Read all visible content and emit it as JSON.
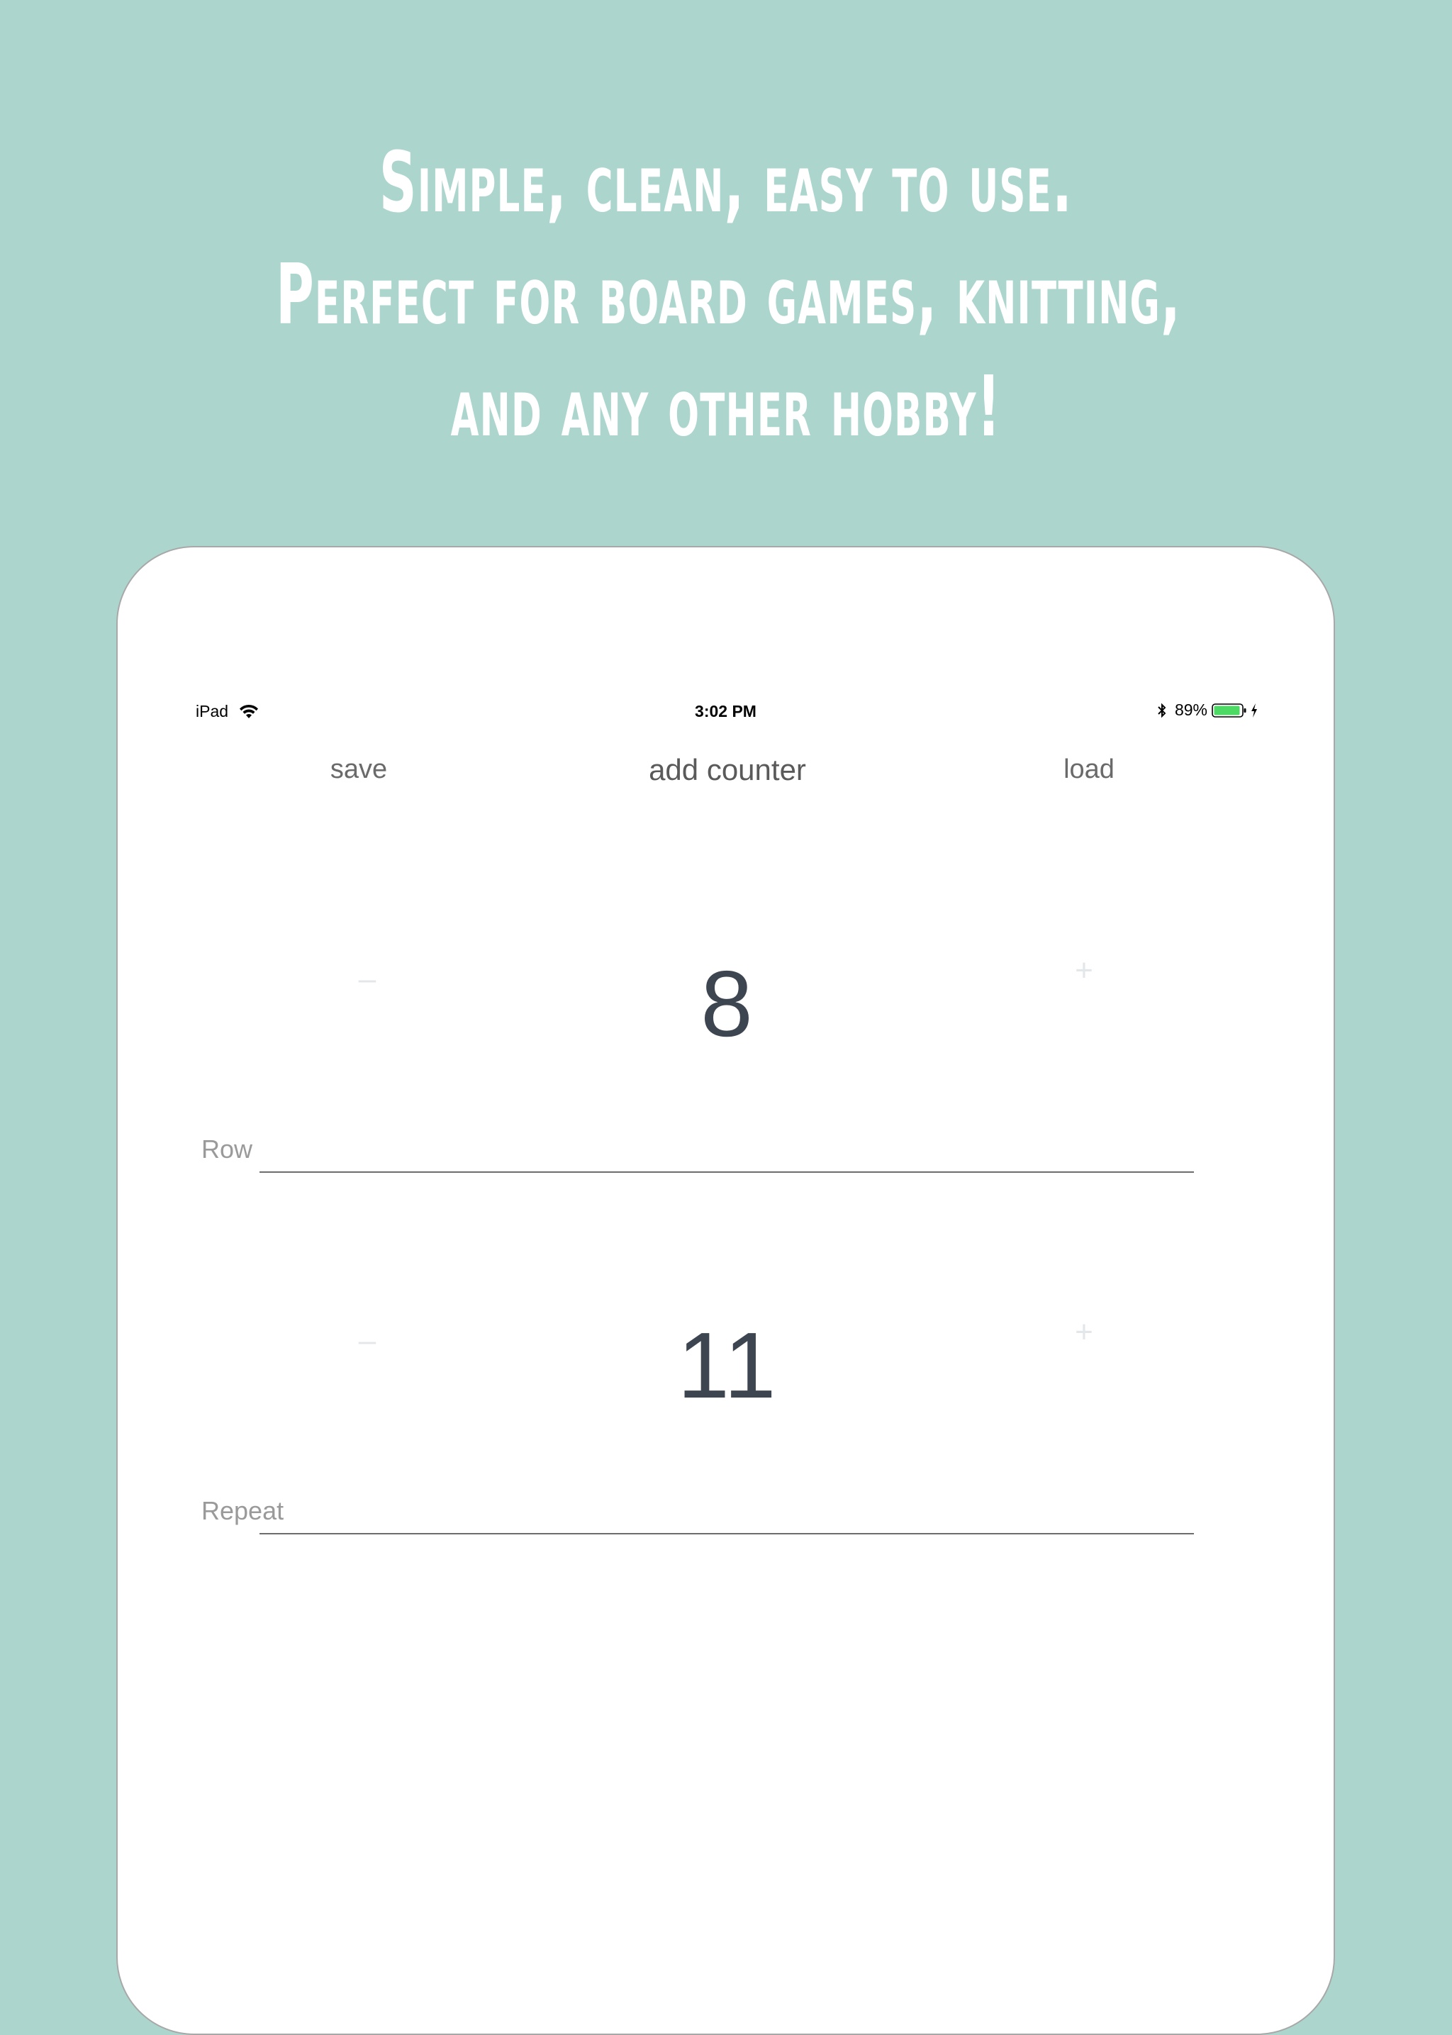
{
  "headline": {
    "line1": "Simple, clean, easy to use.",
    "line2": "Perfect for board games, knitting,",
    "line3": "and any other hobby!"
  },
  "status_bar": {
    "device": "iPad",
    "time": "3:02 PM",
    "battery": "89%",
    "battery_color": "#4cd964",
    "icons": [
      "wifi-icon",
      "bluetooth-icon",
      "battery-icon",
      "charging-icon"
    ]
  },
  "toolbar": {
    "save_label": "save",
    "add_label": "add counter",
    "load_label": "load"
  },
  "counters": [
    {
      "minus": "–",
      "value": "8",
      "plus": "+",
      "label": "Row"
    },
    {
      "minus": "–",
      "value": "11",
      "plus": "+",
      "label": "Repeat"
    }
  ],
  "colors": {
    "background": "#acd6cd",
    "card": "#ffffff"
  }
}
